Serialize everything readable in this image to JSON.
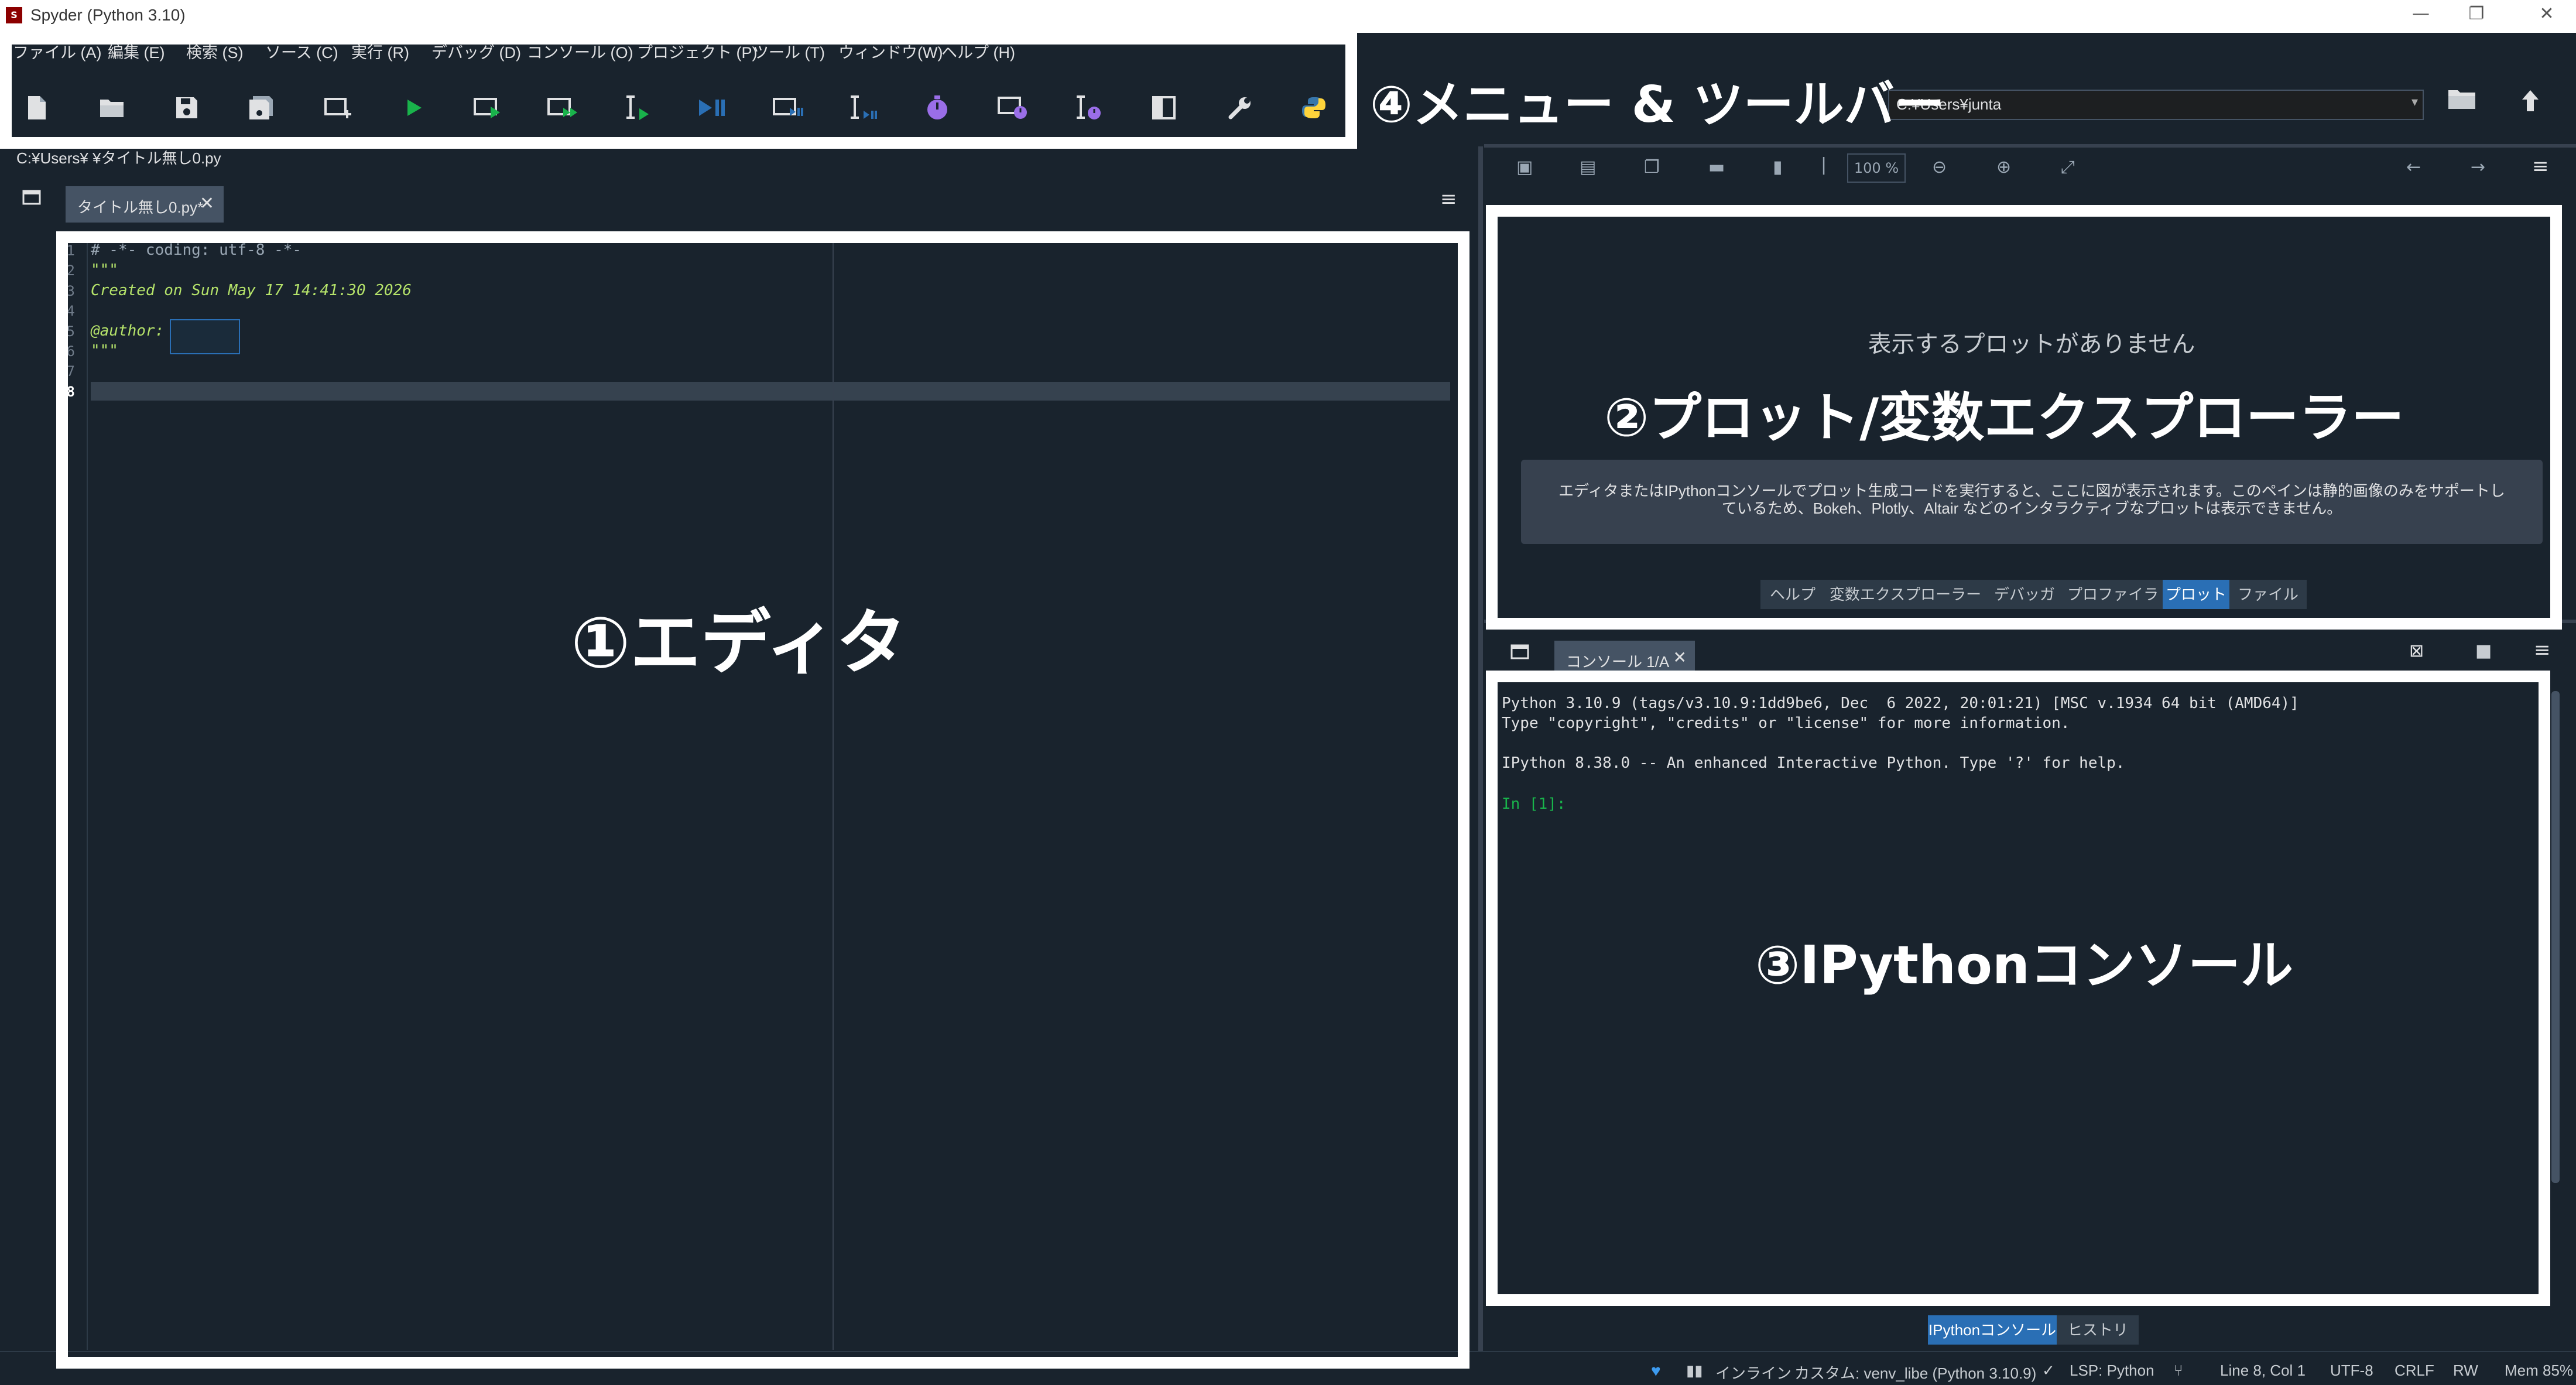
{
  "window": {
    "title": "Spyder (Python 3.10)",
    "app_icon_text": "S",
    "controls": [
      "—",
      "❐",
      "✕"
    ]
  },
  "menubar": [
    {
      "label": "ファイル (A)"
    },
    {
      "label": "編集 (E)"
    },
    {
      "label": "検索 (S)"
    },
    {
      "label": "ソース (C)"
    },
    {
      "label": "実行 (R)"
    },
    {
      "label": "デバッグ (D)"
    },
    {
      "label": "コンソール (O)"
    },
    {
      "label": "プロジェクト (P)"
    },
    {
      "label": "ツール (T)"
    },
    {
      "label": "ウィンドウ(W)"
    },
    {
      "label": "ヘルプ (H)"
    }
  ],
  "toolbar": {
    "icons": [
      "new-file-icon",
      "open-file-icon",
      "save-icon",
      "save-all-icon",
      "new-cell-icon",
      "run-icon",
      "run-cell-icon",
      "run-cell-advance-icon",
      "run-selection-icon",
      "debug-icon",
      "debug-cell-icon",
      "debug-selection-icon",
      "profile-icon",
      "profile-cell-icon",
      "profile-selection-icon",
      "maximize-pane-icon",
      "preferences-icon",
      "python-path-icon"
    ],
    "working_dir": "C:¥Users¥junta",
    "browse_icon": "folder-icon",
    "parent_dir_icon": "up-arrow-icon"
  },
  "editor": {
    "path": "C:¥Users¥      ¥タイトル無し0.py",
    "tab_label": "タイトル無し0.py*",
    "line_numbers": [
      "1",
      "2",
      "3",
      "4",
      "5",
      "6",
      "7",
      "8"
    ],
    "lines": [
      {
        "text": "# -*- coding: utf-8 -*-",
        "style": "comment"
      },
      {
        "text": "\"\"\"",
        "style": "docstr"
      },
      {
        "text": "Created on Sun May 17 14:41:30 2026",
        "style": "docstr"
      },
      {
        "text": "",
        "style": "docstr"
      },
      {
        "text": "@author: ",
        "style": "docstr"
      },
      {
        "text": "\"\"\"",
        "style": "docstr"
      },
      {
        "text": "",
        "style": "docstr"
      },
      {
        "text": "",
        "style": "docstr"
      }
    ]
  },
  "plots": {
    "zoom": "100 %",
    "empty_message": "表示するプロットがありません",
    "hint": "エディタまたはIPythonコンソールでプロット生成コードを実行すると、ここに図が表示されます。このペインは静的画像のみをサポートしているため、Bokeh、Plotly、Altair などのインタラクティブなプロットは表示できません。",
    "tabs": [
      {
        "label": "ヘルプ",
        "active": false
      },
      {
        "label": "変数エクスプローラー",
        "active": false
      },
      {
        "label": "デバッガ",
        "active": false
      },
      {
        "label": "プロファイラ",
        "active": false
      },
      {
        "label": "プロット",
        "active": true
      },
      {
        "label": "ファイル",
        "active": false
      }
    ]
  },
  "console": {
    "tab_label": "コンソール 1/A",
    "lines": [
      "Python 3.10.9 (tags/v3.10.9:1dd9be6, Dec  6 2022, 20:01:21) [MSC v.1934 64 bit (AMD64)]",
      "Type \"copyright\", \"credits\" or \"license\" for more information.",
      "",
      "IPython 8.38.0 -- An enhanced Interactive Python. Type '?' for help.",
      ""
    ],
    "prompt": "In [1]:",
    "bottom_tabs": [
      {
        "label": "IPythonコンソール",
        "active": true
      },
      {
        "label": "ヒストリ",
        "active": false
      }
    ]
  },
  "statusbar": {
    "inline": "インライン",
    "env": "カスタム: venv_libe (Python 3.10.9)",
    "lsp": "LSP: Python",
    "cursor": "Line 8, Col 1",
    "encoding": "UTF-8",
    "eol": "CRLF",
    "mode": "RW",
    "mem": "Mem 85%"
  },
  "annotations": {
    "editor": "①エディタ",
    "plots": "②プロット/変数エクスプローラー",
    "console": "③IPythonコンソール",
    "menu": "④メニュー & ツールバー"
  },
  "colors": {
    "background": "#19232d",
    "accent": "#2a6fb5",
    "prompt": "#19b34b",
    "docstring": "#b5e36a",
    "frame": "#ffffff"
  }
}
